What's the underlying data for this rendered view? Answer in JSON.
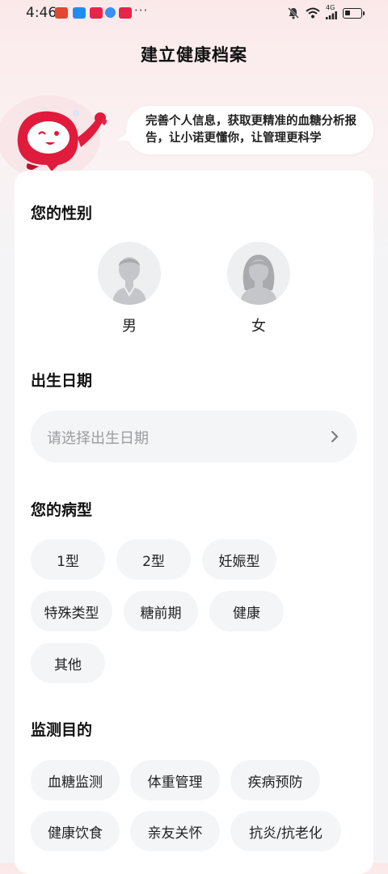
{
  "status_bar": {
    "time": "4:46",
    "more": "···",
    "network": "4G",
    "battery_level": 0.35
  },
  "header": {
    "title": "建立健康档案"
  },
  "banner": {
    "message": "完善个人信息，获取更精准的血糖分析报告，让小诺更懂你，让管理更科学"
  },
  "gender": {
    "title": "您的性别",
    "options": [
      {
        "label": "男",
        "icon": "male-avatar-icon"
      },
      {
        "label": "女",
        "icon": "female-avatar-icon"
      }
    ]
  },
  "birth": {
    "title": "出生日期",
    "placeholder": "请选择出生日期"
  },
  "disease": {
    "title": "您的病型",
    "options": [
      "1型",
      "2型",
      "妊娠型",
      "特殊类型",
      "糖前期",
      "健康",
      "其他"
    ]
  },
  "goals": {
    "title": "监测目的",
    "options": [
      "血糖监测",
      "体重管理",
      "疾病预防",
      "健康饮食",
      "亲友关怀",
      "抗炎/抗老化"
    ]
  },
  "colors": {
    "accent_red": "#e8244a",
    "chip_bg": "#f4f5f7",
    "placeholder": "#9a9ca0"
  }
}
